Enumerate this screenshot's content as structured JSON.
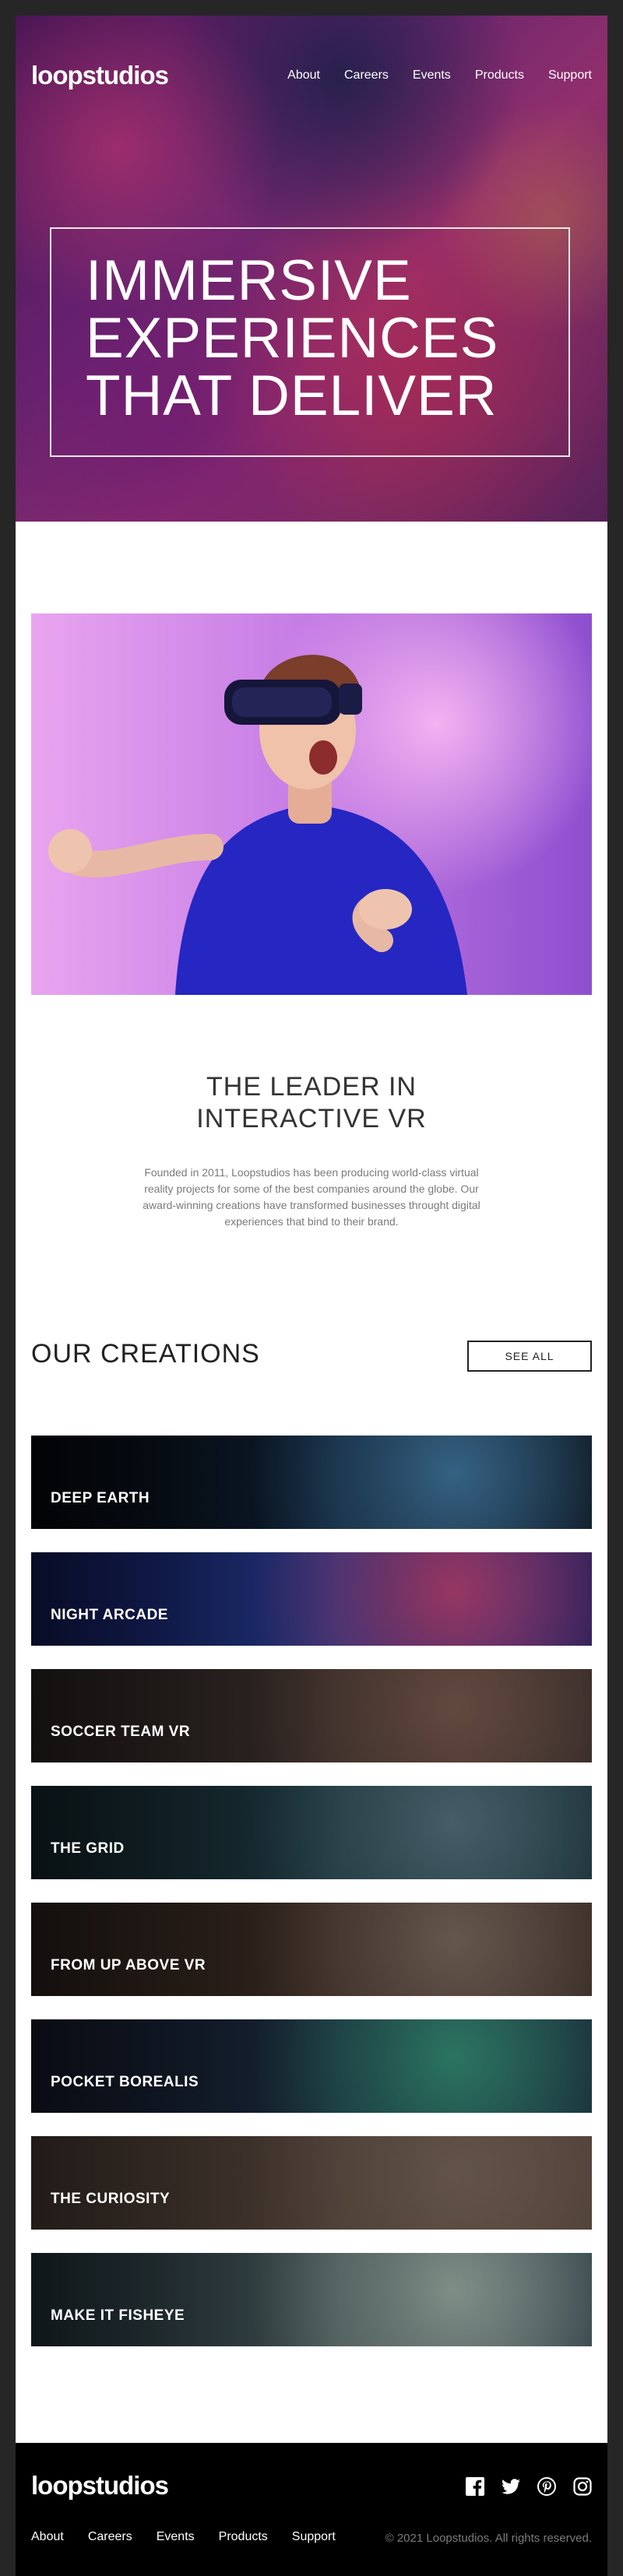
{
  "brand": {
    "logo": "loopstudios"
  },
  "nav": {
    "about": "About",
    "careers": "Careers",
    "events": "Events",
    "products": "Products",
    "support": "Support"
  },
  "hero": {
    "title": "Immersive\nexperiences\nthat deliver"
  },
  "intro": {
    "title": "The leader in\ninteractive VR",
    "text": "Founded in 2011, Loopstudios has been producing world-class virtual reality projects for some of the best companies around the globe. Our award-winning creations have transformed businesses throught digital experiences that bind to their brand."
  },
  "creations": {
    "title": "Our creations",
    "see_all": "See all",
    "items": [
      {
        "label": "Deep earth",
        "colors": [
          "#05070b",
          "#10233a",
          "#3a6a8e"
        ]
      },
      {
        "label": "Night arcade",
        "colors": [
          "#101a55",
          "#283f9a",
          "#a43b6a"
        ]
      },
      {
        "label": "Soccer team VR",
        "colors": [
          "#2a2422",
          "#3c302c",
          "#6b4f45"
        ]
      },
      {
        "label": "The grid",
        "colors": [
          "#14262d",
          "#1f3c45",
          "#4b6670"
        ]
      },
      {
        "label": "From up above VR",
        "colors": [
          "#2c221d",
          "#3e2d24",
          "#6e5e54"
        ]
      },
      {
        "label": "Pocket borealis",
        "colors": [
          "#151b2c",
          "#1c2c40",
          "#2f7f6a"
        ]
      },
      {
        "label": "The curiosity",
        "colors": [
          "#4a3b33",
          "#55453c",
          "#6b5a4e"
        ]
      },
      {
        "label": "Make it fisheye",
        "colors": [
          "#22323a",
          "#4a5d5f",
          "#8b9a93"
        ]
      }
    ]
  },
  "footer": {
    "logo": "loopstudios",
    "copyright": "© 2021 Loopstudios. All rights reserved.",
    "socials": [
      "facebook-icon",
      "twitter-icon",
      "pinterest-icon",
      "instagram-icon"
    ]
  }
}
